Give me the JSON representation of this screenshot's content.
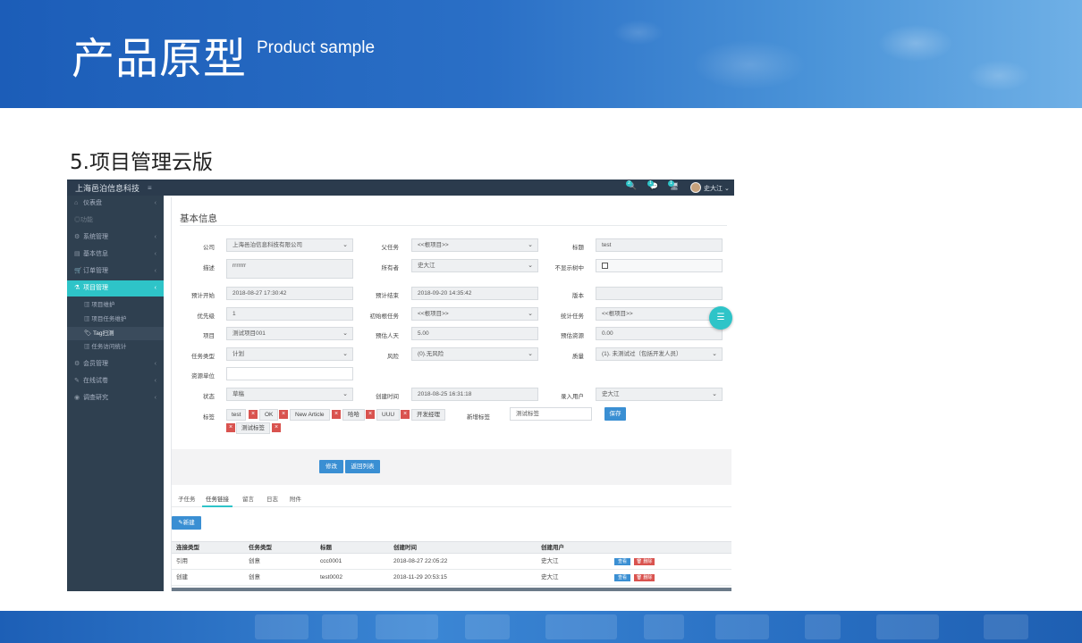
{
  "slide": {
    "title": "产品原型",
    "subtitle": "Product sample",
    "section": "5.项目管理云版"
  },
  "colors": {
    "header_blue": "#1c5db8",
    "sidebar": "#2f4050",
    "accent_teal": "#2ec4c8",
    "button_blue": "#3a8fd3",
    "delete_red": "#d9534f"
  },
  "app": {
    "brand": "上海邑泊信息科技",
    "hamburger_icon": "≡",
    "user_name": "史大江",
    "user_menu_caret": "⌄",
    "notif_badges": [
      "2",
      "1",
      "1"
    ],
    "notif_icons": [
      "🔍",
      "💬",
      "🖥"
    ]
  },
  "sidebar": {
    "items": [
      {
        "label": "仪表盘",
        "icon": "⌂"
      },
      {
        "label": "◎功能",
        "icon": ""
      },
      {
        "label": "系统管理",
        "icon": "⚙"
      },
      {
        "label": "基本信息",
        "icon": "▤"
      },
      {
        "label": "订单管理",
        "icon": "🛒"
      },
      {
        "label": "项目管理",
        "icon": "⚗"
      },
      {
        "label": "会员管理",
        "icon": "⚙"
      },
      {
        "label": "在线试卷",
        "icon": "✎"
      },
      {
        "label": "调查研究",
        "icon": "◉"
      }
    ],
    "subitems": [
      {
        "label": "项目维护",
        "icon": "▥"
      },
      {
        "label": "项目任务维护",
        "icon": "▥"
      },
      {
        "label": "Tag扫测",
        "icon": "🏷"
      },
      {
        "label": "任务访问统计",
        "icon": "▥"
      }
    ]
  },
  "form": {
    "panel_title": "基本信息",
    "company_label": "公司",
    "company_value": "上海邑泊信息科技有限公司",
    "parent_label": "父任务",
    "parent_value": "<<根项目>>",
    "title_label": "标题",
    "title_value": "test",
    "desc_label": "描述",
    "desc_value": "rrrrrrr",
    "owner_label": "所有者",
    "owner_value": "史大江",
    "hide_label": "不显示树中",
    "start_label": "预计开始",
    "start_value": "2018-08-27 17:30:42",
    "end_label": "预计结束",
    "end_value": "2018-09-20 14:35:42",
    "version_label": "版本",
    "version_value": "",
    "priority_label": "优先级",
    "priority_value": "1",
    "init_label": "初始根任务",
    "init_value": "<<根项目>>",
    "stat_label": "统计任务",
    "stat_value": "<<根项目>>",
    "project_label": "项目",
    "project_value": "测试项目001",
    "days_label": "预估人天",
    "days_value": "5.00",
    "resource_label": "预估资源",
    "resource_value": "0.00",
    "type_label": "任务类型",
    "type_value": "计划",
    "risk_label": "风险",
    "risk_value": "(0).无风险",
    "quality_label": "质量",
    "quality_value": "(1). 未测试过（包括开发人员）",
    "unit_label": "资源单位",
    "unit_value": "",
    "status_label": "状态",
    "status_value": "草稿",
    "created_label": "创建时间",
    "created_value": "2018-08-25 16:31:18",
    "recorder_label": "录入用户",
    "recorder_value": "史大江",
    "tags_label": "标签",
    "tags": [
      "test",
      "OK",
      "New Article",
      "哈哈",
      "UUU",
      "开发经理",
      "测试标签"
    ],
    "tag_remove_icon": "×",
    "newtag_label": "新增标签",
    "newtag_value": "测试标签",
    "save_button": "保存",
    "dropdown_icon": "⌄"
  },
  "actions": {
    "edit_button": "修改",
    "back_button": "返回列表"
  },
  "tabs": [
    "子任务",
    "任务链接",
    "留言",
    "日志",
    "附件"
  ],
  "new_button": "✎新建",
  "table": {
    "headers": [
      "连接类型",
      "任务类型",
      "标题",
      "创建时间",
      "创建用户"
    ],
    "rows": [
      [
        "引用",
        "创意",
        "ccc0001",
        "2018-08-27 22:05:22",
        "史大江"
      ],
      [
        "创建",
        "创意",
        "test0002",
        "2018-11-29 20:53:15",
        "史大江"
      ]
    ],
    "view_button": "查看",
    "delete_button": "🗑 删除"
  },
  "fab_icon": "☰"
}
